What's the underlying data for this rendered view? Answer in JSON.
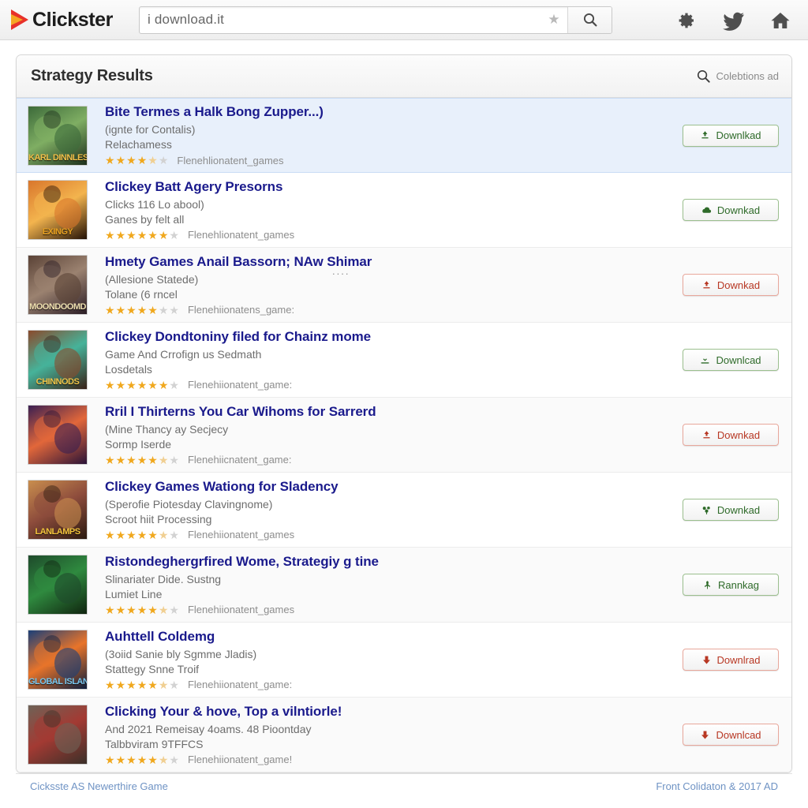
{
  "browser": {
    "brand": "Clickster",
    "logo_icon": "play-triangle-icon",
    "search": {
      "value": "i download.it",
      "placeholder": "Search",
      "favorite_icon": "star-icon",
      "submit_icon": "search-icon"
    },
    "toolbar_icons": [
      {
        "name": "gear-icon",
        "label": "Settings"
      },
      {
        "name": "twitter-icon",
        "label": "Twitter"
      },
      {
        "name": "home-icon",
        "label": "Home"
      }
    ]
  },
  "results_panel": {
    "title": "Strategy Results",
    "search_icon": "search-icon",
    "right_label": "Colebtions ad"
  },
  "results": [
    {
      "title": "Bite Termes a Halk Bong Zupper...)",
      "subtitle": "(ignte for Contalis)",
      "detail": "Relachamess",
      "category": "Flenehlionatent_games",
      "stars_full": 4,
      "stars_half": 1,
      "stars_empty": 1,
      "button": {
        "label": "Downlkad",
        "style": "green",
        "icon": "download-arrow-icon"
      },
      "thumb": {
        "caption": "KARL DINNLES",
        "cap_color": "#f2c14a",
        "c1": "#3c6a3a",
        "c2": "#7fae63",
        "c3": "#1d2f1c",
        "row_style": "selected"
      }
    },
    {
      "title": "Clickey Batt Agery Presorns",
      "subtitle": "Clicks 116 Lo abool)",
      "detail": "Ganes by felt all",
      "category": "Flenehlionatent_games",
      "stars_full": 6,
      "stars_half": 0,
      "stars_empty": 1,
      "button": {
        "label": "Downkad",
        "style": "green",
        "icon": "cloud-download-icon"
      },
      "thumb": {
        "caption": "EXINGY",
        "cap_color": "#e8a020",
        "c1": "#d9762c",
        "c2": "#f3b44e",
        "c3": "#241206",
        "row_style": "white"
      }
    },
    {
      "title": "Hmety Games Anail Bassorn; NAw Shimar",
      "subtitle": "(Allesione Statede)",
      "detail": "Tolane (6 rncel",
      "category": "Flenehiionatens_game:",
      "stars_full": 5,
      "stars_half": 0,
      "stars_empty": 2,
      "trailing_ellipsis": "....",
      "button": {
        "label": "Downkad",
        "style": "red",
        "icon": "download-arrow-icon"
      },
      "thumb": {
        "caption": "MOONDOOMD",
        "cap_color": "#efe0b0",
        "c1": "#5a4236",
        "c2": "#9b8270",
        "c3": "#2a1c25",
        "row_style": "alt"
      }
    },
    {
      "title": "Clickey Dondtoniny filed for Chainz mome",
      "subtitle": "Game And Crrofign us Sedmath",
      "detail": "Losdetals",
      "category": "Flenehiionatent_game:",
      "stars_full": 6,
      "stars_half": 0,
      "stars_empty": 1,
      "button": {
        "label": "Downlcad",
        "style": "green",
        "icon": "download-tray-icon"
      },
      "thumb": {
        "caption": "CHINNODS",
        "cap_color": "#f0c54a",
        "c1": "#8a4a2c",
        "c2": "#46b39a",
        "c3": "#3a2218",
        "row_style": "white"
      }
    },
    {
      "title": "Rril I Thirterns You Car Wihoms for Sarrerd",
      "subtitle": "(Mine Thancy ay Secjecy",
      "detail": "Sormp Iserde",
      "category": "Flenehiicnatent_game:",
      "stars_full": 5,
      "stars_half": 1,
      "stars_empty": 1,
      "button": {
        "label": "Downkad",
        "style": "red",
        "icon": "download-arrow-icon"
      },
      "thumb": {
        "caption": "",
        "cap_color": "#ffffff",
        "c1": "#3a1f52",
        "c2": "#e2673a",
        "c3": "#2a1338",
        "row_style": "alt"
      }
    },
    {
      "title": "Clickey Games Wationg for Sladency",
      "subtitle": "(Sperofie Piotesday Clavingnome)",
      "detail": "Scroot hiit Processing",
      "category": "Flenehiionatent_games",
      "stars_full": 5,
      "stars_half": 1,
      "stars_empty": 1,
      "button": {
        "label": "Downkad",
        "style": "green",
        "icon": "sprout-icon"
      },
      "thumb": {
        "caption": "LANLAMPS",
        "cap_color": "#f3c43c",
        "c1": "#c98e4e",
        "c2": "#8d4c3c",
        "c3": "#2b1a10",
        "row_style": "white"
      }
    },
    {
      "title": "Ristondeghergrfired Wome, Strategiy g tine",
      "subtitle": "Slinariater Dide. Sustng",
      "detail": "Lumiet Line",
      "category": "Flenehiionatent_games",
      "stars_full": 5,
      "stars_half": 1,
      "stars_empty": 1,
      "button": {
        "label": "Rannkag",
        "style": "green",
        "icon": "pin-icon"
      },
      "thumb": {
        "caption": "",
        "cap_color": "#ffffff",
        "c1": "#1e4a2b",
        "c2": "#2f8a3f",
        "c3": "#10240f",
        "row_style": "alt"
      }
    },
    {
      "title": "Auhttell Coldemg",
      "subtitle": "(3oiid Sanie bly Sgmme Jladis)",
      "detail": "Stattegy Snne Troif",
      "category": "Flenehiionatent_game:",
      "stars_full": 5,
      "stars_half": 1,
      "stars_empty": 1,
      "button": {
        "label": "Downlrad",
        "style": "red",
        "icon": "download-solid-icon"
      },
      "thumb": {
        "caption": "GLOBAL ISLANDS",
        "cap_color": "#79c8f0",
        "c1": "#1b3f78",
        "c2": "#e8742a",
        "c3": "#0d1f3e",
        "row_style": "white"
      }
    },
    {
      "title": "Clicking Your & hove, Top a vilntiorle!",
      "subtitle": "And 2021 Remeisay 4oams. 48 Pioontday",
      "detail": "Talbbviram 9TFFCS",
      "category": "Flenehiionatent_game!",
      "stars_full": 5,
      "stars_half": 1,
      "stars_empty": 1,
      "button": {
        "label": "Downlcad",
        "style": "red",
        "icon": "download-solid-icon"
      },
      "thumb": {
        "caption": "",
        "cap_color": "#ffffff",
        "c1": "#6e6256",
        "c2": "#a33a33",
        "c3": "#3a3029",
        "row_style": "alt"
      }
    }
  ],
  "footer": {
    "left": "Cicksste AS Newerthire Game",
    "right": "Front Colidaton & 2017 AD"
  },
  "colors": {
    "title_link": "#1a1a8c",
    "star_on": "#f0a81e",
    "btn_green": "#2f6b2a",
    "btn_red": "#b83824",
    "footer_link": "#6f93c4",
    "selected_row": "#e8f0fb"
  }
}
